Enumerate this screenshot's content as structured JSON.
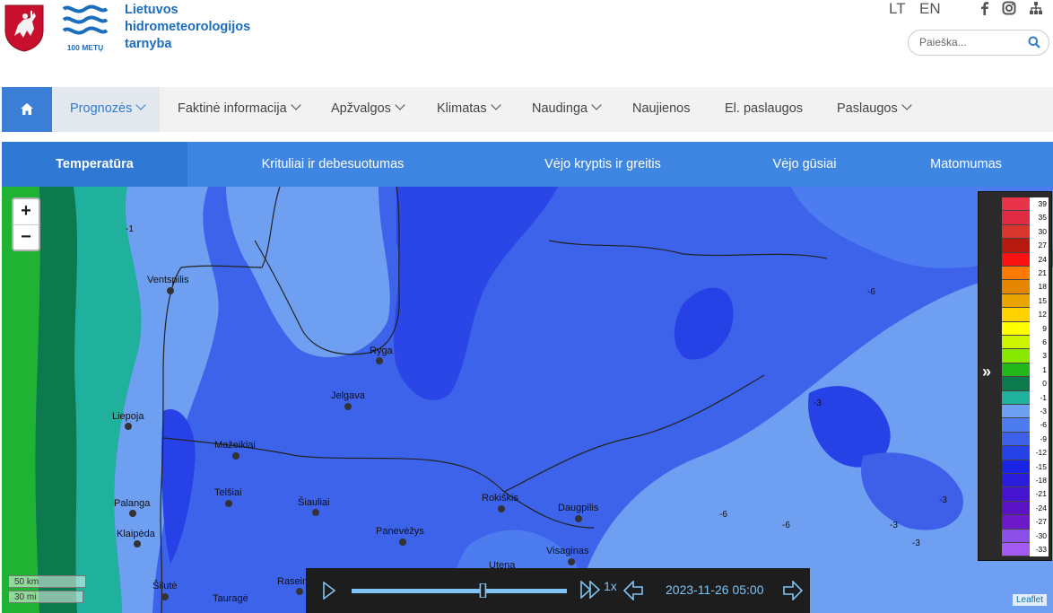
{
  "header": {
    "brand_line1": "Lietuvos",
    "brand_line2": "hidrometeorologijos",
    "brand_line3": "tarnyba",
    "logo_caption": "100 METŲ",
    "lang_lt": "LT",
    "lang_en": "EN",
    "search_placeholder": "Paieška...",
    "brand_color": "#1c6dbd"
  },
  "nav": {
    "items": [
      {
        "label": "Prognozės",
        "dropdown": true,
        "active": true
      },
      {
        "label": "Faktinė informacija",
        "dropdown": true
      },
      {
        "label": "Apžvalgos",
        "dropdown": true
      },
      {
        "label": "Klimatas",
        "dropdown": true
      },
      {
        "label": "Naudinga",
        "dropdown": true
      },
      {
        "label": "Naujienos",
        "dropdown": false
      },
      {
        "label": "El. paslaugos",
        "dropdown": false
      },
      {
        "label": "Paslaugos",
        "dropdown": true
      }
    ]
  },
  "tabs": [
    {
      "label": "Temperatūra",
      "active": true
    },
    {
      "label": "Krituliai ir debesuotumas"
    },
    {
      "label": "Vėjo kryptis ir greitis"
    },
    {
      "label": "Vėjo gūsiai"
    },
    {
      "label": "Matomumas"
    }
  ],
  "map": {
    "zoom_in": "+",
    "zoom_out": "−",
    "scale_km": "50 km",
    "scale_mi": "30 mi",
    "attribution": "Leaflet",
    "cities": [
      {
        "name": "Ventspilis"
      },
      {
        "name": "Ryga"
      },
      {
        "name": "Jelgava"
      },
      {
        "name": "Liepoja"
      },
      {
        "name": "Mažeikiai"
      },
      {
        "name": "Telšiai"
      },
      {
        "name": "Šiauliai"
      },
      {
        "name": "Rokiškis"
      },
      {
        "name": "Daugpilis"
      },
      {
        "name": "Palanga"
      },
      {
        "name": "Klaipėda"
      },
      {
        "name": "Panevėžys"
      },
      {
        "name": "Visaginas"
      },
      {
        "name": "Utena"
      },
      {
        "name": "Šilutė"
      },
      {
        "name": "Tauragė"
      },
      {
        "name": "Raseiniai"
      }
    ],
    "contour_labels": [
      "-1",
      "-3",
      "-6",
      "-3",
      "-6",
      "-3",
      "-6",
      "-3"
    ]
  },
  "legend": {
    "toggle": "»",
    "entries": [
      {
        "label": "39",
        "color": "#e8334a"
      },
      {
        "label": "35",
        "color": "#e12b45"
      },
      {
        "label": "30",
        "color": "#d9352f"
      },
      {
        "label": "27",
        "color": "#b5190f"
      },
      {
        "label": "24",
        "color": "#fa1212"
      },
      {
        "label": "21",
        "color": "#ff7a00"
      },
      {
        "label": "18",
        "color": "#e58600"
      },
      {
        "label": "15",
        "color": "#e9a400"
      },
      {
        "label": "12",
        "color": "#ffd200"
      },
      {
        "label": "9",
        "color": "#ffff00"
      },
      {
        "label": "6",
        "color": "#ccf400"
      },
      {
        "label": "3",
        "color": "#88e800"
      },
      {
        "label": "1",
        "color": "#22b81a"
      },
      {
        "label": "0",
        "color": "#0c7a4d"
      },
      {
        "label": "-1",
        "color": "#1fb19c"
      },
      {
        "label": "-3",
        "color": "#6f9ff0"
      },
      {
        "label": "-6",
        "color": "#4d7bf0"
      },
      {
        "label": "-9",
        "color": "#3e5fe8"
      },
      {
        "label": "-12",
        "color": "#2641e6"
      },
      {
        "label": "-15",
        "color": "#1a24e6"
      },
      {
        "label": "-18",
        "color": "#2a1ddc"
      },
      {
        "label": "-21",
        "color": "#4514d0"
      },
      {
        "label": "-24",
        "color": "#5a12c4"
      },
      {
        "label": "-27",
        "color": "#6b19c9"
      },
      {
        "label": "-30",
        "color": "#8a50e8"
      },
      {
        "label": "-33",
        "color": "#a25af0"
      }
    ]
  },
  "player": {
    "speed": "1x",
    "datetime": "2023-11-26 05:00",
    "progress": 0.61,
    "accent_color": "#7ec3f3"
  }
}
